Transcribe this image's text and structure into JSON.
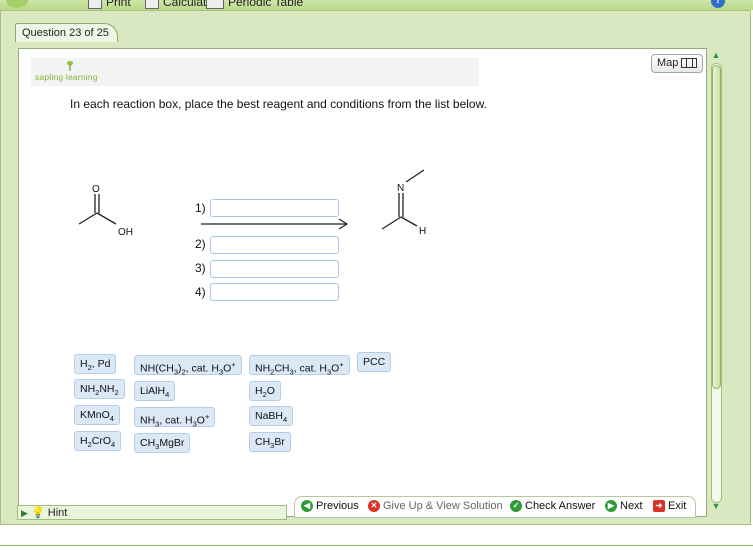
{
  "toolbar": {
    "print_label": "Print",
    "calculator_label": "Calculator",
    "periodic_label": "Periodic Table",
    "help_label": "?"
  },
  "question": {
    "tab": "Question 23 of 25"
  },
  "brand": {
    "name": "sapling learning"
  },
  "map": {
    "label": "Map"
  },
  "content": {
    "instructions": "In each reaction box, place the best reagent and conditions from the list below.",
    "reactant_o": "O",
    "reactant_oh": "OH",
    "product_n": "N",
    "product_h": "H",
    "slots": [
      "1)",
      "2)",
      "3)",
      "4)"
    ]
  },
  "reagents": {
    "h2_pd": "H2, Pd",
    "nhme2": "NH(CH3)2, cat. H3O+",
    "nh2me": "NH2CH3, cat. H3O+",
    "pcc": "PCC",
    "hydrazine": "NH2NH2",
    "lialh4": "LiAlH4",
    "h2o": "H2O",
    "kmno4": "KMnO4",
    "nh3": "NH3, cat. H3O+",
    "nabh4": "NaBH4",
    "h2cro4": "H2CrO4",
    "ch3mgbr": "CH3MgBr",
    "ch3br": "CH3Br"
  },
  "footer": {
    "hint": "Hint",
    "previous": "Previous",
    "giveup": "Give Up & View Solution",
    "check": "Check Answer",
    "next": "Next",
    "exit": "Exit"
  },
  "colors": {
    "accent_green": "#2e9a3a",
    "frame": "#d9e8c0",
    "tile": "#dbe8f6",
    "slot_border": "#a9c6e8"
  }
}
